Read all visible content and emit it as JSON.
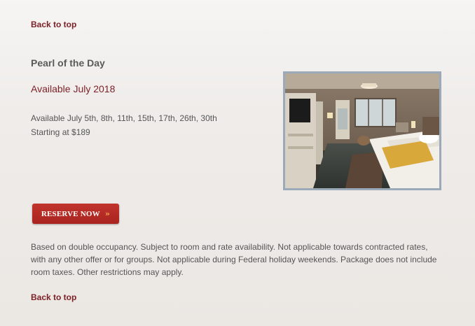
{
  "nav": {
    "back_to_top": "Back to top"
  },
  "package": {
    "title": "Pearl of the Day",
    "subtitle": "Available July 2018",
    "availability": "Available July 5th, 8th, 11th, 15th, 17th, 26th, 30th",
    "price": "Starting at $189"
  },
  "reserve": {
    "label": "RESERVE NOW",
    "chevron": "»"
  },
  "disclaimer": "Based on double occupancy. Subject to room and rate availability. Not applicable towards contracted rates, with any other offer or for groups. Not applicable during Federal holiday weekends. Package does not include room taxes. Other restrictions may apply.",
  "colors": {
    "accent": "#7d1f26",
    "button": "#b52a25",
    "image_border": "#9aaab8"
  }
}
